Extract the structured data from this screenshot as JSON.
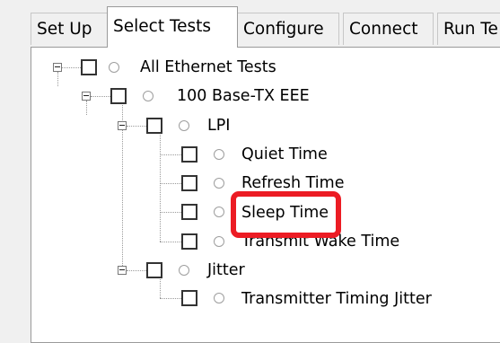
{
  "tabs": [
    {
      "label": "Set Up"
    },
    {
      "label": "Select Tests"
    },
    {
      "label": "Configure"
    },
    {
      "label": "Connect"
    },
    {
      "label": "Run Te"
    }
  ],
  "active_tab": "Select Tests",
  "tree": {
    "nodes": [
      {
        "label": "All Ethernet Tests",
        "checked": false,
        "expanded": true
      },
      {
        "label": "100 Base-TX EEE",
        "checked": false,
        "expanded": true
      },
      {
        "label": "LPI",
        "checked": false,
        "expanded": true
      },
      {
        "label": "Quiet Time",
        "checked": false
      },
      {
        "label": "Refresh Time",
        "checked": false
      },
      {
        "label": "Sleep Time",
        "checked": false,
        "highlighted": true
      },
      {
        "label": "Transmit Wake Time",
        "checked": false
      },
      {
        "label": "Jitter",
        "checked": false,
        "expanded": true
      },
      {
        "label": "Transmitter Timing Jitter",
        "checked": false
      }
    ]
  },
  "colors": {
    "highlight": "#ec1c24",
    "panel_bg": "#ffffff",
    "window_bg": "#f0f0f0"
  }
}
